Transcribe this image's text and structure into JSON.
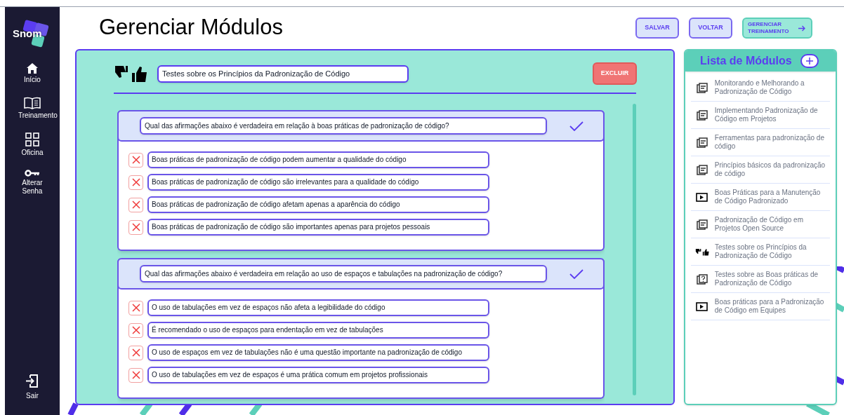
{
  "sidebar": {
    "logo": "Snom",
    "items": [
      {
        "label": "Início",
        "kind": "home"
      },
      {
        "label": "Treinamento",
        "kind": "book"
      },
      {
        "label": "Oficina",
        "kind": "grid"
      },
      {
        "label": "Alterar Senha",
        "kind": "key"
      }
    ],
    "logout": {
      "label": "Sair"
    }
  },
  "page_title": "Gerenciar Módulos",
  "header_buttons": [
    {
      "label": "SALVAR",
      "kind": "plain"
    },
    {
      "label": "VOLTAR",
      "kind": "plain"
    },
    {
      "label": "GERENCIAR TREINAMENTO",
      "kind": "forward"
    }
  ],
  "module_editor": {
    "kind": "quiz-rating",
    "title_value": "Testes sobre os Princípios da Padronização de Código",
    "delete_button": "EXCLUIR",
    "questions": [
      {
        "question": "Qual das afirmações abaixo é verdadeira em relação à boas práticas de padronização de código?",
        "answers": [
          {
            "text": "Boas práticas de padronização de código podem aumentar a qualidade do código",
            "correct": false
          },
          {
            "text": "Boas práticas de padronização de código são irrelevantes para a qualidade do código",
            "correct": false
          },
          {
            "text": "Boas práticas de padronização de código afetam apenas a aparência do código",
            "correct": false
          },
          {
            "text": "Boas práticas de padronização de código são importantes apenas para projetos pessoais",
            "correct": false
          }
        ]
      },
      {
        "question": "Qual das afirmações abaixo é verdadeira em relação ao uso de espaços e tabulações na padronização de código?",
        "answers": [
          {
            "text": "O uso de tabulações em vez de espaços não afeta a legibilidade do código",
            "correct": false
          },
          {
            "text": "É recomendado o uso de espaços para endentação em vez de tabulações",
            "correct": false
          },
          {
            "text": "O uso de espaços em vez de tabulações não é uma questão importante na padronização de código",
            "correct": false
          },
          {
            "text": "O uso de tabulações em vez de espaços é uma prática comum em projetos profissionais",
            "correct": false
          }
        ]
      }
    ]
  },
  "module_list": {
    "title": "Lista de Módulos",
    "items": [
      {
        "label": "Monitorando e Melhorando a Padronização de Código",
        "kind": "text"
      },
      {
        "label": "Implementando Padronização de Código em Projetos",
        "kind": "text"
      },
      {
        "label": "Ferramentas para padronização de código",
        "kind": "text"
      },
      {
        "label": "Princípios básicos da padronização de código",
        "kind": "text"
      },
      {
        "label": "Boas Práticas para a Manutenção de Código Padronizado",
        "kind": "video"
      },
      {
        "label": "Padronização de Código em Projetos Open Source",
        "kind": "text"
      },
      {
        "label": "Testes sobre os Princípios da Padronização de Código",
        "kind": "quiz-rating"
      },
      {
        "label": "Testes sobre as Boas práticas de Padronização de Código",
        "kind": "quiz"
      },
      {
        "label": "Boas práticas para a Padronização de Código em Equipes",
        "kind": "video"
      }
    ]
  }
}
